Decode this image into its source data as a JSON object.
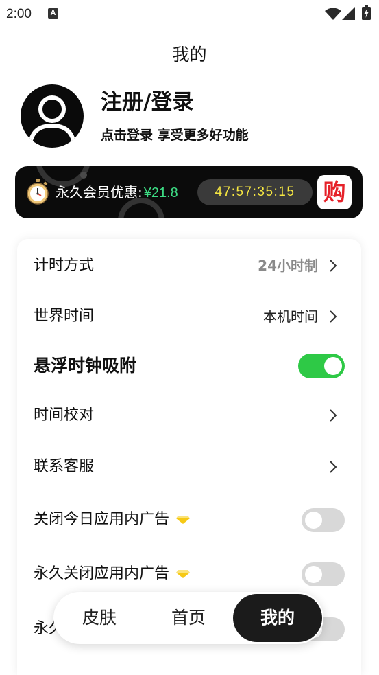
{
  "status_bar": {
    "time": "2:00",
    "notification_glyph": "A",
    "icons": [
      "wifi-icon",
      "signal-icon",
      "battery-charging-icon"
    ]
  },
  "header": {
    "title": "我的"
  },
  "profile": {
    "avatar_icon": "user-avatar-icon",
    "login_title": "注册/登录",
    "login_subtitle": "点击登录 享受更多好功能"
  },
  "promo_banner": {
    "icon": "stopwatch-icon",
    "label": "永久会员优惠:",
    "price": "¥21.8",
    "countdown": "47:57:35:15",
    "buy_label": "购"
  },
  "settings": {
    "rows": [
      {
        "label": "计时方式",
        "value": "24小时制",
        "chevron": true
      },
      {
        "label": "世界时间",
        "value": "本机时间",
        "chevron": true
      },
      {
        "label": "悬浮时钟吸附",
        "toggle_on": true
      },
      {
        "label": "时间校对",
        "chevron": true
      },
      {
        "label": "联系客服",
        "chevron": true
      },
      {
        "label": "关闭今日应用内广告",
        "badge_icon": "vip-diamond-icon",
        "toggle_on": false
      },
      {
        "label": "永久关闭应用内广告",
        "badge_icon": "vip-diamond-icon",
        "toggle_on": false
      },
      {
        "label": "永久",
        "toggle_on": false
      }
    ]
  },
  "bottom_nav": {
    "items": [
      {
        "label": "皮肤",
        "active": false
      },
      {
        "label": "首页",
        "active": false
      },
      {
        "label": "我的",
        "active": true
      }
    ]
  },
  "colors": {
    "toggle_on": "#2ec946",
    "toggle_off": "#d8d8d8",
    "price_green": "#3ddc84",
    "countdown_yellow": "#f5e642",
    "buy_red": "#e62129",
    "banner_bg": "#0b0b0b",
    "nav_active_bg": "#1b1b1b",
    "vip_diamond": "#f6c915"
  }
}
